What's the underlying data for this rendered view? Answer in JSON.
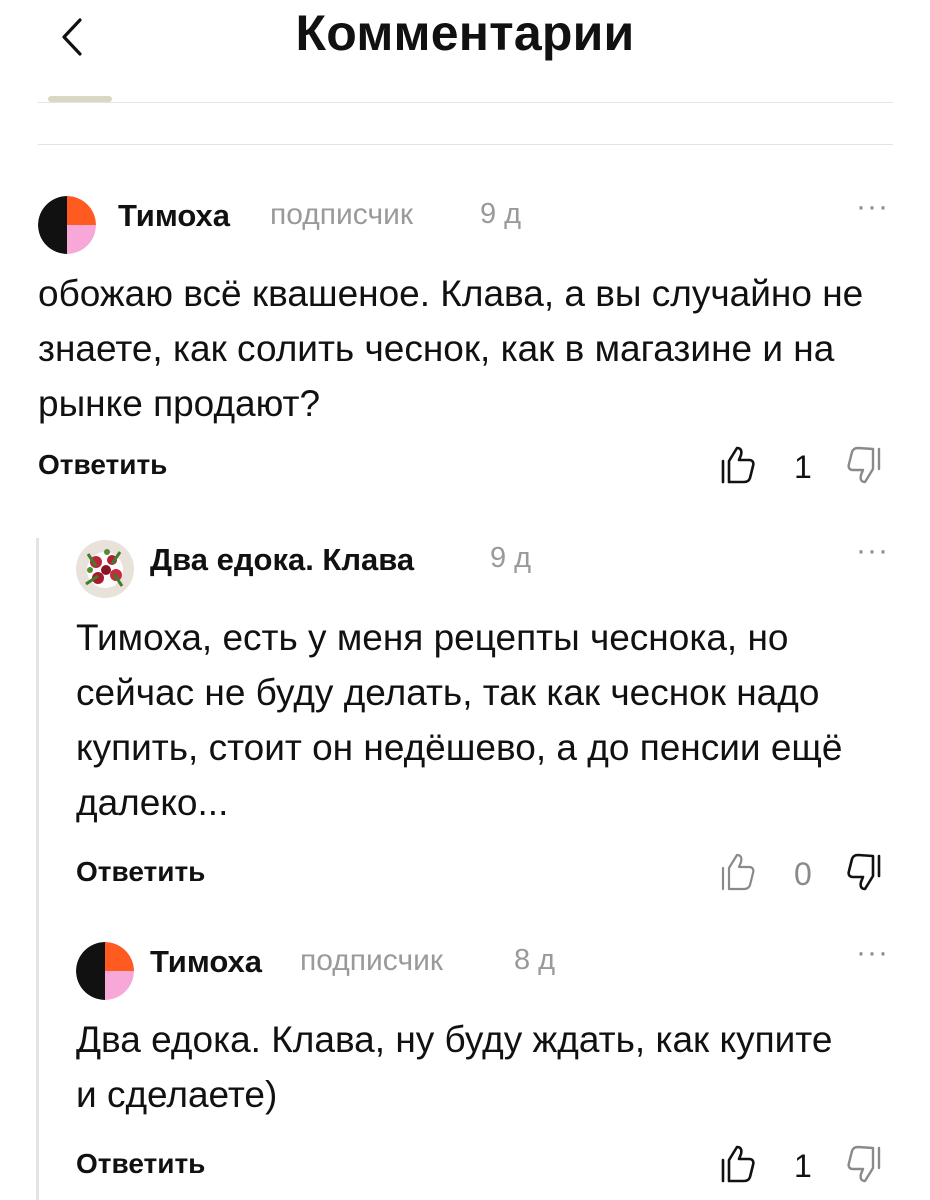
{
  "header": {
    "title": "Комментарии"
  },
  "comments": [
    {
      "author": "Тимоха",
      "badge": "подписчик",
      "time": "9 д",
      "text": "обожаю всё квашеное. Клава, а вы случайно не знаете, как солить чеснок, как в магазине и на рынке продают?",
      "reply_label": "Ответить",
      "likes": "1",
      "avatar_colors": [
        "#111111",
        "#ff5a1f",
        "#f7a8d8"
      ]
    },
    {
      "author": "Два едока. Клава",
      "badge": "",
      "time": "9 д",
      "text": "Тимоха, есть у меня рецепты чеснока, но сейчас не буду делать, так как чеснок надо купить, стоит он недёшево, а до пенсии ещё далеко...",
      "reply_label": "Ответить",
      "likes": "0"
    },
    {
      "author": "Тимоха",
      "badge": "подписчик",
      "time": "8 д",
      "text": "Два едока. Клава, ну буду ждать, как купите и сделаете)",
      "reply_label": "Ответить",
      "likes": "1",
      "avatar_colors": [
        "#111111",
        "#ff5a1f",
        "#f7a8d8"
      ]
    }
  ],
  "icons": {
    "back": "chevron-left-icon",
    "more": "more-horizontal-icon",
    "like": "thumb-up-icon",
    "dislike": "thumb-down-icon"
  },
  "more_glyph": "···"
}
